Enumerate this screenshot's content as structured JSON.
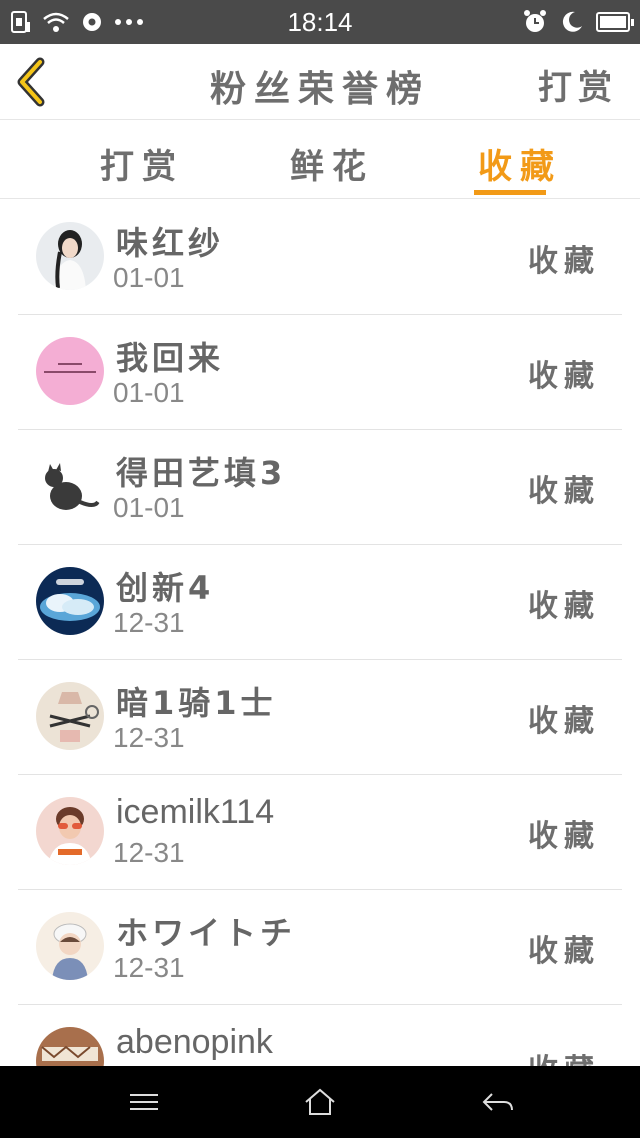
{
  "status_bar": {
    "time": "18:14",
    "icons": [
      "sim-icon",
      "wifi-icon",
      "notification-icon",
      "more-dots-icon",
      "alarm-icon",
      "moon-icon",
      "battery-icon"
    ]
  },
  "header": {
    "title": "粉丝荣誉榜",
    "action_label": "打赏"
  },
  "tabs": [
    {
      "label": "打赏",
      "active": false
    },
    {
      "label": "鲜花",
      "active": false
    },
    {
      "label": "收藏",
      "active": true
    }
  ],
  "colors": {
    "accent": "#f29a17",
    "status_bar": "#4a4a4a",
    "text": "#666666"
  },
  "rows": [
    {
      "name": "味红纱",
      "date": "01-01",
      "action": "收藏"
    },
    {
      "name": "我回来",
      "date": "01-01",
      "action": "收藏"
    },
    {
      "name": "得田艺填3",
      "date": "01-01",
      "action": "收藏"
    },
    {
      "name": "创新4",
      "date": "12-31",
      "action": "收藏"
    },
    {
      "name": "暗1骑1士",
      "date": "12-31",
      "action": "收藏"
    },
    {
      "name": "icemilk114",
      "date": "12-31",
      "action": "收藏"
    },
    {
      "name": "ホワイトチ",
      "date": "12-31",
      "action": "收藏"
    },
    {
      "name": "abenopink",
      "date": "",
      "action": "收藏"
    }
  ],
  "nav": [
    "menu-icon",
    "home-icon",
    "back-arrow-icon"
  ]
}
